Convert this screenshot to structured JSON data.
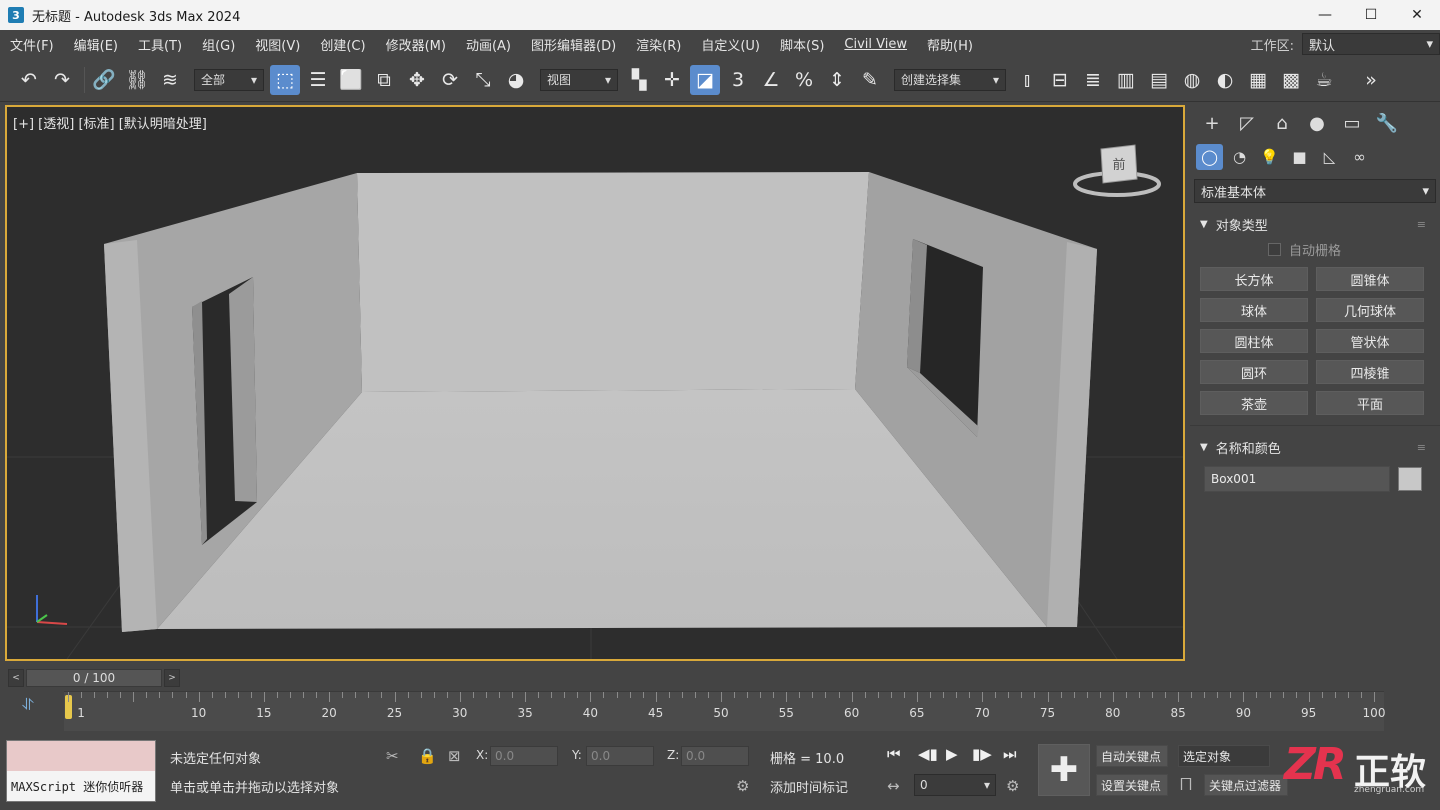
{
  "window": {
    "title": "无标题 - Autodesk 3ds Max 2024",
    "app_icon": "3",
    "minimize": "—",
    "maximize": "☐",
    "close": "✕"
  },
  "menu": [
    "文件(F)",
    "编辑(E)",
    "工具(T)",
    "组(G)",
    "视图(V)",
    "创建(C)",
    "修改器(M)",
    "动画(A)",
    "图形编辑器(D)",
    "渲染(R)",
    "自定义(U)",
    "脚本(S)",
    "Civil View",
    "帮助(H)"
  ],
  "workspace": {
    "label": "工作区:",
    "value": "默认"
  },
  "toolbar": {
    "selection_filter": "全部",
    "reference_coord": "视图",
    "named_selection": "创建选择集"
  },
  "viewport": {
    "label": "[+] [透视] [标准] [默认明暗处理]",
    "viewcube_face": "前"
  },
  "command_panel": {
    "category": "标准基本体",
    "object_type_title": "对象类型",
    "autogrid": "自动栅格",
    "primitives": [
      "长方体",
      "圆锥体",
      "球体",
      "几何球体",
      "圆柱体",
      "管状体",
      "圆环",
      "四棱锥",
      "茶壶",
      "平面"
    ],
    "name_color_title": "名称和颜色",
    "object_name": "Box001",
    "object_color": "#c8c8c8"
  },
  "timeline": {
    "slider": "0 / 100",
    "current_frame": 0,
    "start": 0,
    "end": 100,
    "tick_labels": [
      "0",
      "1",
      "10",
      "15",
      "20",
      "25",
      "30",
      "35",
      "40",
      "45",
      "50",
      "55",
      "60",
      "65",
      "70",
      "75",
      "80",
      "85",
      "90",
      "95",
      "100"
    ]
  },
  "status": {
    "maxscript_label": "MAXScript 迷你侦听器",
    "selection_info": "未选定任何对象",
    "prompt": "单击或单击并拖动以选择对象",
    "x_label": "X:",
    "x_value": "0.0",
    "y_label": "Y:",
    "y_value": "0.0",
    "z_label": "Z:",
    "z_value": "0.0",
    "grid": "栅格 = 10.0",
    "add_time_tag": "添加时间标记",
    "frame_value": "0",
    "auto_key": "自动关键点",
    "set_key": "设置关键点",
    "key_mode_select": "选定对象",
    "key_filters": "关键点过滤器"
  },
  "watermark": {
    "logo": "ZR",
    "text": "正软",
    "site": "zhengruan.com"
  },
  "colors": {
    "viewport_border": "#d9a93a",
    "active_button": "#5b8ccd",
    "time_marker": "#e7c84c",
    "logo_red": "#e4334e"
  }
}
